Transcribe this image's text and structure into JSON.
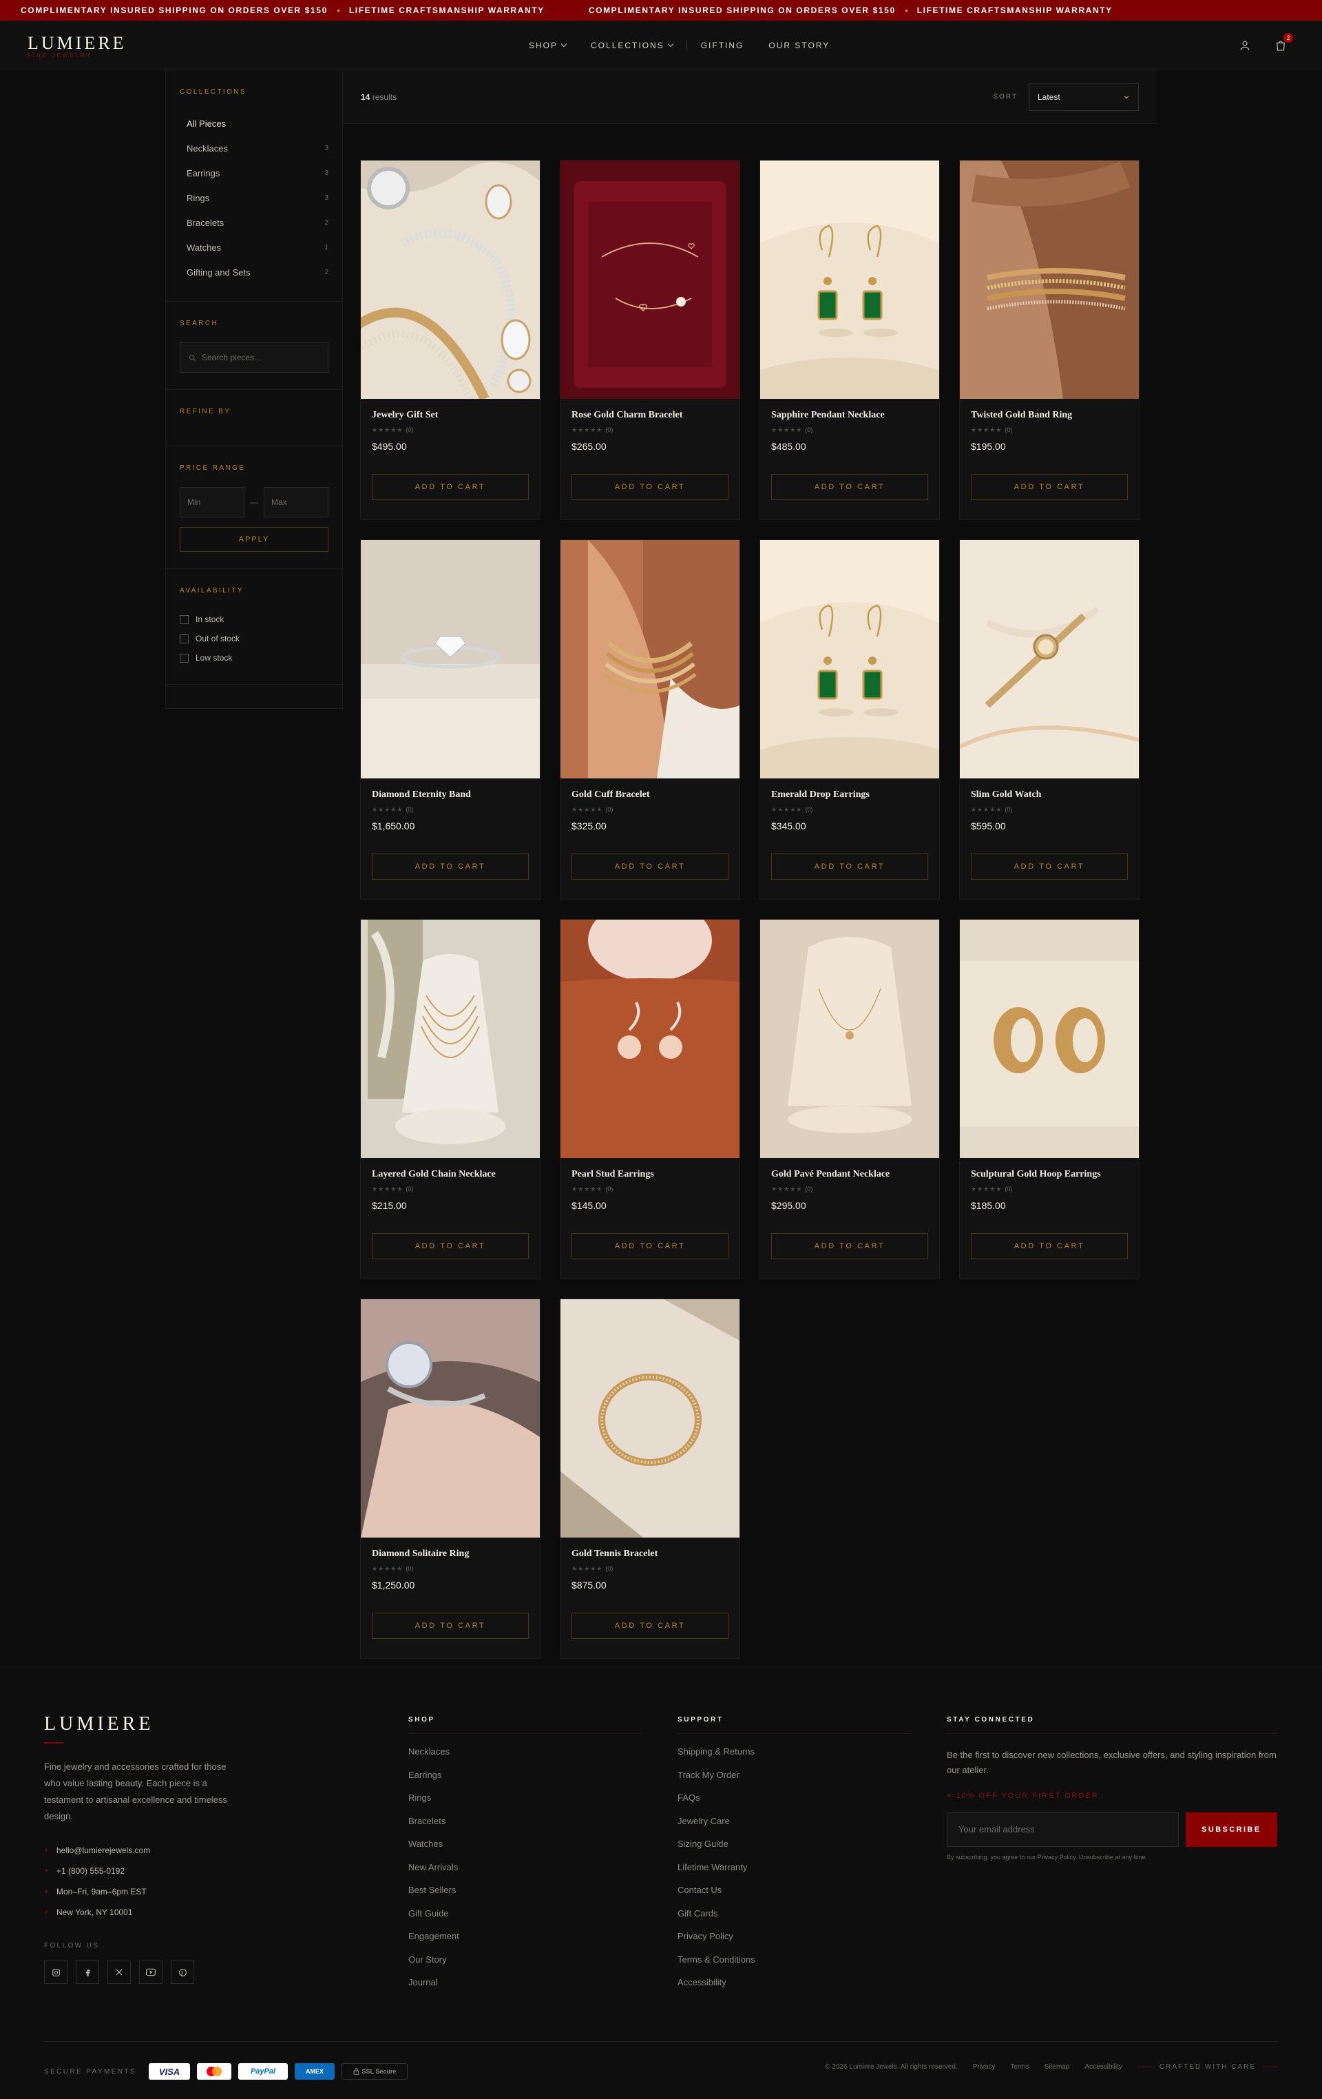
{
  "promo": {
    "items": [
      "COMPLIMENTARY INSURED SHIPPING ON ORDERS OVER $150",
      "LIFETIME CRAFTSMANSHIP WARRANTY",
      "COMPLIMENTARY INSURED SHIPPING ON ORDERS OVER $150",
      "LIFETIME CRAFTSMANSHIP WARRANTY"
    ]
  },
  "header": {
    "logo": "LUMIERE",
    "logo_tag": "FINE JEWELRY",
    "nav": [
      "SHOP",
      "COLLECTIONS",
      "GIFTING",
      "OUR STORY"
    ],
    "cart_count": "2",
    "icons": [
      "user-icon",
      "cart-icon",
      "chevron-down-icon"
    ]
  },
  "sidebar": {
    "collections_heading": "COLLECTIONS",
    "collections": [
      {
        "label": "All Pieces",
        "count": ""
      },
      {
        "label": "Necklaces",
        "count": "3"
      },
      {
        "label": "Earrings",
        "count": "3"
      },
      {
        "label": "Rings",
        "count": "3"
      },
      {
        "label": "Bracelets",
        "count": "2"
      },
      {
        "label": "Watches",
        "count": "1"
      },
      {
        "label": "Gifting and Sets",
        "count": "2"
      }
    ],
    "search_heading": "SEARCH",
    "search_placeholder": "Search pieces...",
    "refine_heading": "REFINE BY",
    "price_heading": "PRICE RANGE",
    "price_min": "Min",
    "price_sep": "—",
    "price_max": "Max",
    "apply_label": "APPLY",
    "availability_heading": "AVAILABILITY",
    "availability": [
      "In stock",
      "Out of stock",
      "Low stock"
    ]
  },
  "results": {
    "count": "14",
    "count_label": "results",
    "sort_label": "SORT",
    "sort_value": "Latest"
  },
  "products": [
    {
      "name": "Jewelry Gift Set",
      "price": "$495.00",
      "reviews": "(0)",
      "art": "giftset"
    },
    {
      "name": "Rose Gold Charm Bracelet",
      "price": "$265.00",
      "reviews": "(0)",
      "art": "boxbracelet"
    },
    {
      "name": "Sapphire Pendant Necklace",
      "price": "$485.00",
      "reviews": "(0)",
      "art": "emeraldearrings"
    },
    {
      "name": "Twisted Gold Band Ring",
      "price": "$195.00",
      "reviews": "(0)",
      "art": "handring"
    },
    {
      "name": "Diamond Eternity Band",
      "price": "$1,650.00",
      "reviews": "(0)",
      "art": "solitaire"
    },
    {
      "name": "Gold Cuff Bracelet",
      "price": "$325.00",
      "reviews": "(0)",
      "art": "wristbangles"
    },
    {
      "name": "Emerald Drop Earrings",
      "price": "$345.00",
      "reviews": "(0)",
      "art": "emeraldearrings"
    },
    {
      "name": "Slim Gold Watch",
      "price": "$595.00",
      "reviews": "(0)",
      "art": "watch"
    },
    {
      "name": "Layered Gold Chain Necklace",
      "price": "$215.00",
      "reviews": "(0)",
      "art": "layeredbust"
    },
    {
      "name": "Pearl Stud Earrings",
      "price": "$145.00",
      "reviews": "(0)",
      "art": "pearls"
    },
    {
      "name": "Gold Pavé Pendant Necklace",
      "price": "$295.00",
      "reviews": "(0)",
      "art": "pendantbust"
    },
    {
      "name": "Sculptural Gold Hoop Earrings",
      "price": "$185.00",
      "reviews": "(0)",
      "art": "hoops"
    },
    {
      "name": "Diamond Solitaire Ring",
      "price": "$1,250.00",
      "reviews": "(0)",
      "art": "fingerring"
    },
    {
      "name": "Gold Tennis Bracelet",
      "price": "$875.00",
      "reviews": "(0)",
      "art": "tennis"
    }
  ],
  "add_to_cart_label": "ADD TO CART",
  "footer": {
    "logo": "LUMIERE",
    "description": "Fine jewelry and accessories crafted for those who value lasting beauty. Each piece is a testament to artisanal excellence and timeless design.",
    "contact": [
      "hello@lumierejewels.com",
      "+1 (800) 555-0192",
      "Mon–Fri, 9am–6pm EST",
      "New York, NY 10001"
    ],
    "follow_label": "FOLLOW US",
    "socials": [
      "instagram-icon",
      "facebook-icon",
      "x-icon",
      "youtube-icon",
      "pinterest-icon"
    ],
    "shop_heading": "SHOP",
    "shop_links": [
      "Necklaces",
      "Earrings",
      "Rings",
      "Bracelets",
      "Watches",
      "New Arrivals",
      "Best Sellers",
      "Gift Guide",
      "Engagement",
      "Our Story",
      "Journal"
    ],
    "support_heading": "SUPPORT",
    "support_links": [
      "Shipping & Returns",
      "Track My Order",
      "FAQs",
      "Jewelry Care",
      "Sizing Guide",
      "Lifetime Warranty",
      "Contact Us",
      "Gift Cards",
      "Privacy Policy",
      "Terms & Conditions",
      "Accessibility"
    ],
    "stay_heading": "STAY CONNECTED",
    "stay_text": "Be the first to discover new collections, exclusive offers, and styling inspiration from our atelier.",
    "offer": "10% OFF YOUR FIRST ORDER",
    "email_placeholder": "Your email address",
    "subscribe_label": "SUBSCRIBE",
    "fine_print": "By subscribing, you agree to our Privacy Policy. Unsubscribe at any time.",
    "secure_label": "SECURE PAYMENTS",
    "payments": [
      "VISA",
      "",
      "PayPal",
      "AMEX",
      "SSL Secure"
    ],
    "copyright": "© 2026 Lumiere Jewels. All rights reserved.",
    "legal": [
      "Privacy",
      "Terms",
      "Sitemap",
      "Accessibility"
    ],
    "crafted": "CRAFTED WITH CARE"
  }
}
